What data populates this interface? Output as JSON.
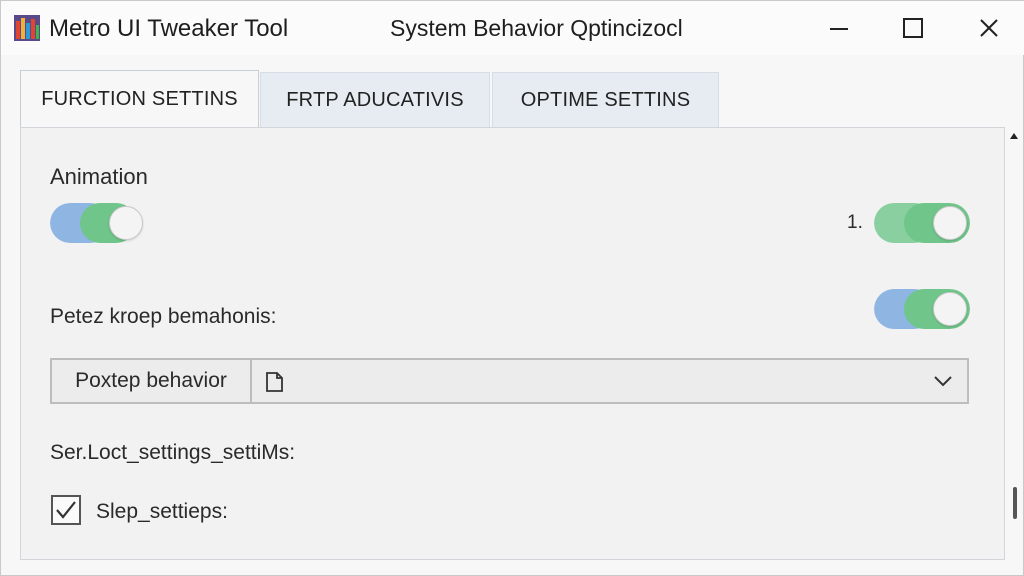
{
  "window": {
    "app_title": "Metro UI Tweaker Tool",
    "title": "System Behavior Qptincizocl"
  },
  "tabs": [
    {
      "label": "FURCTION SETTINS",
      "active": true
    },
    {
      "label": "FRTP ADUCATIVIS",
      "active": false
    },
    {
      "label": "OPTIME SETTINS",
      "active": false
    }
  ],
  "settings": {
    "animation_label": "Animation",
    "animation_on": true,
    "row_number": "1.",
    "second_toggle_on": true,
    "behavior_label": "Petez kroep bemahonis:",
    "behavior_on": true,
    "combo_label": "Poxtep behavior",
    "combo_value": "",
    "section_label": "Ser.Loct_settings_settiMs:",
    "checkbox_label": "Slep_settieps:",
    "checkbox_checked": true
  },
  "colors": {
    "toggle_blue": "#8fb5e3",
    "toggle_green": "#6fc58a",
    "accent_text": "#222222"
  },
  "icons": [
    "app-icon",
    "minimize-icon",
    "maximize-icon",
    "close-icon",
    "document-icon",
    "chevron-down-icon",
    "checkmark-icon",
    "scroll-up-arrow-icon"
  ]
}
